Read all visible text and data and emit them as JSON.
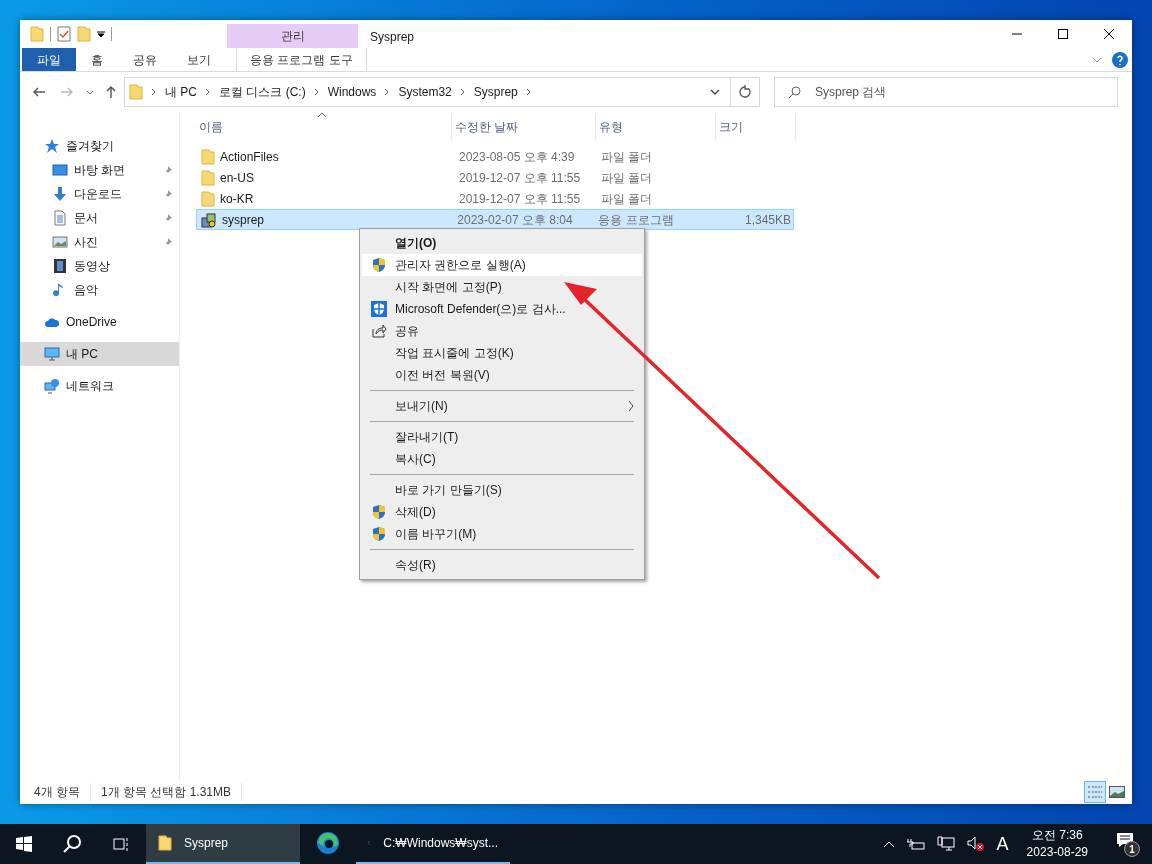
{
  "window": {
    "title": "Sysprep",
    "context_group": "관리"
  },
  "ribbon": {
    "tabs": [
      {
        "label": "파일",
        "kind": "file"
      },
      {
        "label": "홈",
        "kind": "normal"
      },
      {
        "label": "공유",
        "kind": "normal"
      },
      {
        "label": "보기",
        "kind": "normal"
      },
      {
        "label": "응용 프로그램 도구",
        "kind": "context"
      }
    ]
  },
  "address": {
    "breadcrumbs": [
      "내 PC",
      "로컬 디스크 (C:)",
      "Windows",
      "System32",
      "Sysprep"
    ]
  },
  "search": {
    "placeholder": "Sysprep 검색"
  },
  "nav": [
    {
      "label": "즐겨찾기",
      "kind": "star",
      "selected": false,
      "pinned": false,
      "children": [
        {
          "label": "바탕 화면",
          "kind": "desktop",
          "selected": false,
          "pinned": true
        },
        {
          "label": "다운로드",
          "kind": "download",
          "selected": false,
          "pinned": true
        },
        {
          "label": "문서",
          "kind": "document",
          "selected": false,
          "pinned": true
        },
        {
          "label": "사진",
          "kind": "picture",
          "selected": false,
          "pinned": true
        },
        {
          "label": "동영상",
          "kind": "video",
          "selected": false,
          "pinned": false
        },
        {
          "label": "음악",
          "kind": "music",
          "selected": false,
          "pinned": false
        }
      ]
    },
    {
      "label": "OneDrive",
      "kind": "cloud",
      "selected": false,
      "pinned": false
    },
    {
      "label": "내 PC",
      "kind": "pc",
      "selected": true,
      "pinned": false
    },
    {
      "label": "네트워크",
      "kind": "network",
      "selected": false,
      "pinned": false
    }
  ],
  "table": {
    "columns": [
      {
        "label": "이름",
        "sorted": true
      },
      {
        "label": "수정한 날짜",
        "sorted": false
      },
      {
        "label": "유형",
        "sorted": false
      },
      {
        "label": "크기",
        "sorted": false
      }
    ],
    "rows": [
      {
        "name": "ActionFiles",
        "modified": "2023-08-05 오후 4:39",
        "type": "파일 폴더",
        "kind": "folder",
        "selected": false
      },
      {
        "name": "en-US",
        "modified": "2019-12-07 오후 11:55",
        "type": "파일 폴더",
        "kind": "folder",
        "selected": false
      },
      {
        "name": "ko-KR",
        "modified": "2019-12-07 오후 11:55",
        "type": "파일 폴더",
        "kind": "folder",
        "selected": false
      },
      {
        "name": "sysprep",
        "modified": "2023-02-07 오후 8:04",
        "type": "응용 프로그램",
        "size": "1,345KB",
        "kind": "app",
        "selected": true
      }
    ]
  },
  "context_menu": {
    "groups": [
      [
        {
          "label": "열기(O)",
          "kind": "plain",
          "bold": true,
          "selected": false
        },
        {
          "label": "관리자 권한으로 실행(A)",
          "kind": "shield",
          "bold": false,
          "selected": true
        },
        {
          "label": "시작 화면에 고정(P)",
          "kind": "plain",
          "bold": false,
          "selected": false
        },
        {
          "label": "Microsoft Defender(으)로 검사...",
          "kind": "defender",
          "bold": false,
          "selected": false
        },
        {
          "label": "공유",
          "kind": "share",
          "bold": false,
          "selected": false
        },
        {
          "label": "작업 표시줄에 고정(K)",
          "kind": "plain",
          "bold": false,
          "selected": false
        },
        {
          "label": "이전 버전 복원(V)",
          "kind": "plain",
          "bold": false,
          "selected": false
        }
      ],
      [
        {
          "label": "보내기(N)",
          "kind": "plain",
          "bold": false,
          "selected": false,
          "submenu": true
        }
      ],
      [
        {
          "label": "잘라내기(T)",
          "kind": "plain",
          "bold": false,
          "selected": false
        },
        {
          "label": "복사(C)",
          "kind": "plain",
          "bold": false,
          "selected": false
        }
      ],
      [
        {
          "label": "바로 가기 만들기(S)",
          "kind": "plain",
          "bold": false,
          "selected": false
        },
        {
          "label": "삭제(D)",
          "kind": "shield",
          "bold": false,
          "selected": false
        },
        {
          "label": "이름 바꾸기(M)",
          "kind": "shield",
          "bold": false,
          "selected": false
        }
      ],
      [
        {
          "label": "속성(R)",
          "kind": "plain",
          "bold": false,
          "selected": false
        }
      ]
    ]
  },
  "status_bar": {
    "items": [
      "4개 항목",
      "1개 항목 선택함 1.31MB"
    ],
    "views": [
      {
        "kind": "details",
        "selected": true
      },
      {
        "kind": "large_icons",
        "selected": false
      }
    ]
  },
  "taskbar": {
    "apps": [
      {
        "label": "Sysprep",
        "kind": "folder",
        "active": true,
        "running": true
      },
      {
        "kind": "edge",
        "active": false,
        "running": false
      },
      {
        "label": "C:₩Windows₩syst...",
        "kind": "console",
        "active": false,
        "running": true
      }
    ],
    "ime": "A",
    "time": "오전 7:36",
    "date": "2023-08-29",
    "notifications": "1"
  }
}
